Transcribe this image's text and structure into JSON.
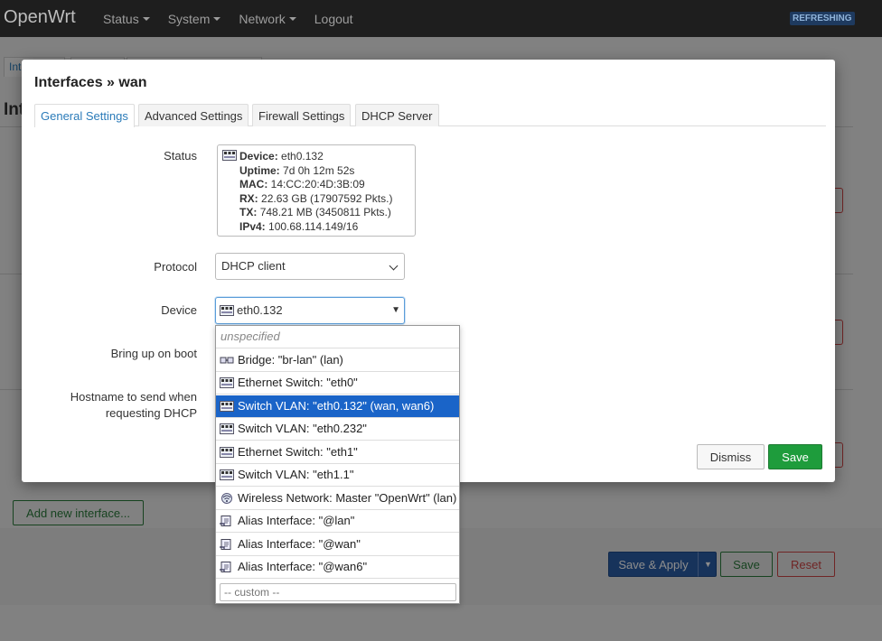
{
  "navbar": {
    "brand": "OpenWrt",
    "menu": [
      {
        "label": "Status",
        "has_caret": true
      },
      {
        "label": "System",
        "has_caret": true
      },
      {
        "label": "Network",
        "has_caret": true
      },
      {
        "label": "Logout",
        "has_caret": false
      }
    ],
    "indicator": "REFRESHING"
  },
  "background": {
    "title_fragment": "Int",
    "tab_fragment": "Int",
    "add_interface_label": "Add new interface...",
    "save_apply_label": "Save & Apply",
    "save_label": "Save",
    "reset_label": "Reset"
  },
  "modal": {
    "title": "Interfaces » wan",
    "tabs": [
      {
        "label": "General Settings",
        "active": true
      },
      {
        "label": "Advanced Settings",
        "active": false
      },
      {
        "label": "Firewall Settings",
        "active": false
      },
      {
        "label": "DHCP Server",
        "active": false
      }
    ],
    "fields": {
      "status_label": "Status",
      "protocol_label": "Protocol",
      "device_label": "Device",
      "boot_label": "Bring up on boot",
      "hostname_label_1": "Hostname to send when",
      "hostname_label_2": "requesting DHCP"
    },
    "status": {
      "device_key": "Device:",
      "device_val": "eth0.132",
      "uptime_key": "Uptime:",
      "uptime_val": "7d 0h 12m 52s",
      "mac_key": "MAC:",
      "mac_val": "14:CC:20:4D:3B:09",
      "rx_key": "RX:",
      "rx_val": "22.63 GB (17907592 Pkts.)",
      "tx_key": "TX:",
      "tx_val": "748.21 MB (3450811 Pkts.)",
      "ipv4_key": "IPv4:",
      "ipv4_val": "100.68.114.149/16"
    },
    "protocol_value": "DHCP client",
    "device_value": "eth0.132",
    "dismiss_label": "Dismiss",
    "save_label": "Save"
  },
  "device_dropdown": {
    "items": [
      {
        "label": "unspecified",
        "icon": "none",
        "selected": false
      },
      {
        "label": "Bridge: \"br-lan\" (lan)",
        "icon": "bridge-icon",
        "selected": false
      },
      {
        "label": "Ethernet Switch: \"eth0\"",
        "icon": "switch-icon",
        "selected": false
      },
      {
        "label": "Switch VLAN: \"eth0.132\" (wan, wan6)",
        "icon": "switch-icon",
        "selected": true
      },
      {
        "label": "Switch VLAN: \"eth0.232\"",
        "icon": "switch-icon",
        "selected": false
      },
      {
        "label": "Ethernet Switch: \"eth1\"",
        "icon": "switch-icon",
        "selected": false
      },
      {
        "label": "Switch VLAN: \"eth1.1\"",
        "icon": "switch-icon",
        "selected": false
      },
      {
        "label": "Wireless Network: Master \"OpenWrt\" (lan)",
        "icon": "wifi-icon",
        "selected": false
      },
      {
        "label": "Alias Interface: \"@lan\"",
        "icon": "alias-icon",
        "selected": false
      },
      {
        "label": "Alias Interface: \"@wan\"",
        "icon": "alias-icon",
        "selected": false
      },
      {
        "label": "Alias Interface: \"@wan6\"",
        "icon": "alias-icon",
        "selected": false
      }
    ],
    "custom_placeholder": "-- custom --"
  },
  "colors": {
    "navbar_bg": "#1e1e1e",
    "accent_blue": "#2b7bb9",
    "selected_bg": "#1a64c8",
    "save_green": "#1e9c3c",
    "reset_red": "#cc4444"
  }
}
